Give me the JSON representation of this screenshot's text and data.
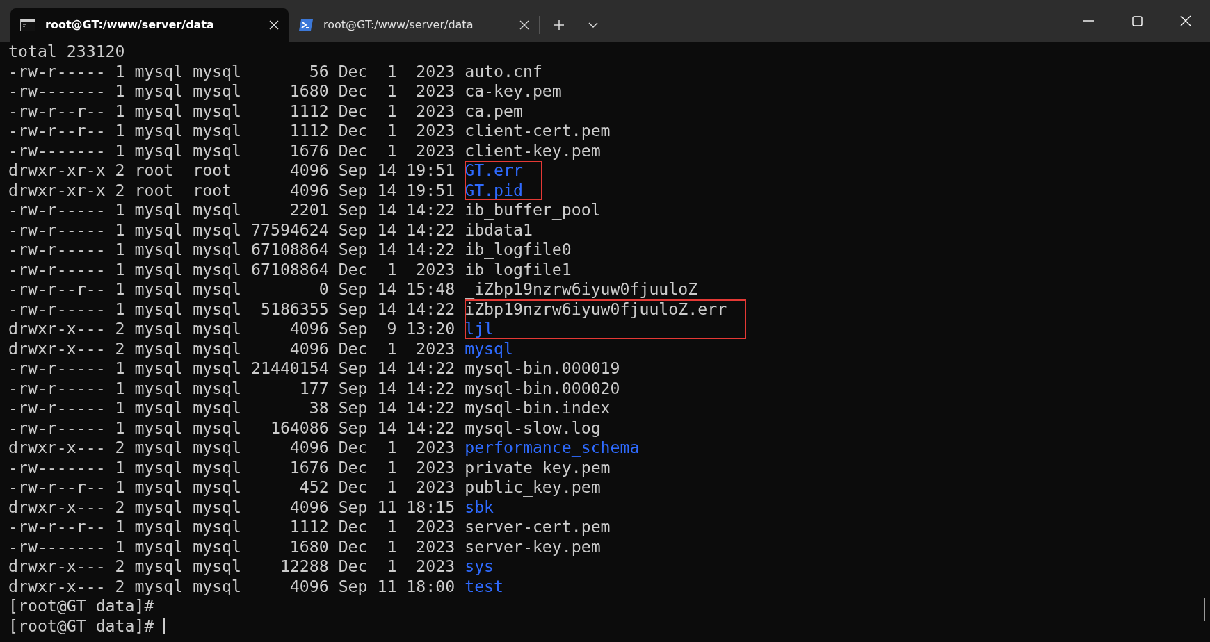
{
  "tabs": [
    {
      "kind": "console",
      "title": "root@GT:/www/server/data",
      "selected": true
    },
    {
      "kind": "powershell",
      "title": "root@GT:/www/server/data",
      "selected": false
    }
  ],
  "listing": {
    "header": "total 233120",
    "blocks": [
      {
        "highlighted": false,
        "entries": [
          {
            "meta": "-rw-r----- 1 mysql mysql       56 Dec  1  2023",
            "name": "auto.cnf",
            "dir": false
          },
          {
            "meta": "-rw------- 1 mysql mysql     1680 Dec  1  2023",
            "name": "ca-key.pem",
            "dir": false
          },
          {
            "meta": "-rw-r--r-- 1 mysql mysql     1112 Dec  1  2023",
            "name": "ca.pem",
            "dir": false
          },
          {
            "meta": "-rw-r--r-- 1 mysql mysql     1112 Dec  1  2023",
            "name": "client-cert.pem",
            "dir": false
          },
          {
            "meta": "-rw------- 1 mysql mysql     1676 Dec  1  2023",
            "name": "client-key.pem",
            "dir": false
          }
        ]
      },
      {
        "highlighted": true,
        "entries": [
          {
            "meta": "drwxr-xr-x 2 root  root      4096 Sep 14 19:51",
            "name": "GT.err",
            "dir": true
          },
          {
            "meta": "drwxr-xr-x 2 root  root      4096 Sep 14 19:51",
            "name": "GT.pid",
            "dir": true
          }
        ]
      },
      {
        "highlighted": false,
        "entries": [
          {
            "meta": "-rw-r----- 1 mysql mysql     2201 Sep 14 14:22",
            "name": "ib_buffer_pool",
            "dir": false
          },
          {
            "meta": "-rw-r----- 1 mysql mysql 77594624 Sep 14 14:22",
            "name": "ibdata1",
            "dir": false
          },
          {
            "meta": "-rw-r----- 1 mysql mysql 67108864 Sep 14 14:22",
            "name": "ib_logfile0",
            "dir": false
          },
          {
            "meta": "-rw-r----- 1 mysql mysql 67108864 Dec  1  2023",
            "name": "ib_logfile1",
            "dir": false
          },
          {
            "meta": "-rw-r--r-- 1 mysql mysql        0 Sep 14 15:48",
            "name": "_iZbp19nzrw6iyuw0fjuuloZ",
            "dir": false
          }
        ]
      },
      {
        "highlighted": true,
        "entries": [
          {
            "meta": "-rw-r----- 1 mysql mysql  5186355 Sep 14 14:22",
            "name": "iZbp19nzrw6iyuw0fjuuloZ.err",
            "dir": false
          },
          {
            "meta": "drwxr-x--- 2 mysql mysql     4096 Sep  9 13:20",
            "name": "ljl",
            "dir": true
          }
        ]
      },
      {
        "highlighted": false,
        "entries": [
          {
            "meta": "drwxr-x--- 2 mysql mysql     4096 Dec  1  2023",
            "name": "mysql",
            "dir": true
          },
          {
            "meta": "-rw-r----- 1 mysql mysql 21440154 Sep 14 14:22",
            "name": "mysql-bin.000019",
            "dir": false
          },
          {
            "meta": "-rw-r----- 1 mysql mysql      177 Sep 14 14:22",
            "name": "mysql-bin.000020",
            "dir": false
          },
          {
            "meta": "-rw-r----- 1 mysql mysql       38 Sep 14 14:22",
            "name": "mysql-bin.index",
            "dir": false
          },
          {
            "meta": "-rw-r----- 1 mysql mysql   164086 Sep 14 14:22",
            "name": "mysql-slow.log",
            "dir": false
          },
          {
            "meta": "drwxr-x--- 2 mysql mysql     4096 Dec  1  2023",
            "name": "performance_schema",
            "dir": true
          },
          {
            "meta": "-rw------- 1 mysql mysql     1676 Dec  1  2023",
            "name": "private_key.pem",
            "dir": false
          },
          {
            "meta": "-rw-r--r-- 1 mysql mysql      452 Dec  1  2023",
            "name": "public_key.pem",
            "dir": false
          },
          {
            "meta": "drwxr-x--- 2 mysql mysql     4096 Sep 11 18:15",
            "name": "sbk",
            "dir": true
          },
          {
            "meta": "-rw-r--r-- 1 mysql mysql     1112 Dec  1  2023",
            "name": "server-cert.pem",
            "dir": false
          },
          {
            "meta": "-rw------- 1 mysql mysql     1680 Dec  1  2023",
            "name": "server-key.pem",
            "dir": false
          },
          {
            "meta": "drwxr-x--- 2 mysql mysql    12288 Dec  1  2023",
            "name": "sys",
            "dir": true
          },
          {
            "meta": "drwxr-x--- 2 mysql mysql     4096 Sep 11 18:00",
            "name": "test",
            "dir": true
          }
        ]
      }
    ]
  },
  "prompts": [
    {
      "text": "[root@GT data]#",
      "cursor": false
    },
    {
      "text": "[root@GT data]#",
      "cursor": true
    }
  ]
}
